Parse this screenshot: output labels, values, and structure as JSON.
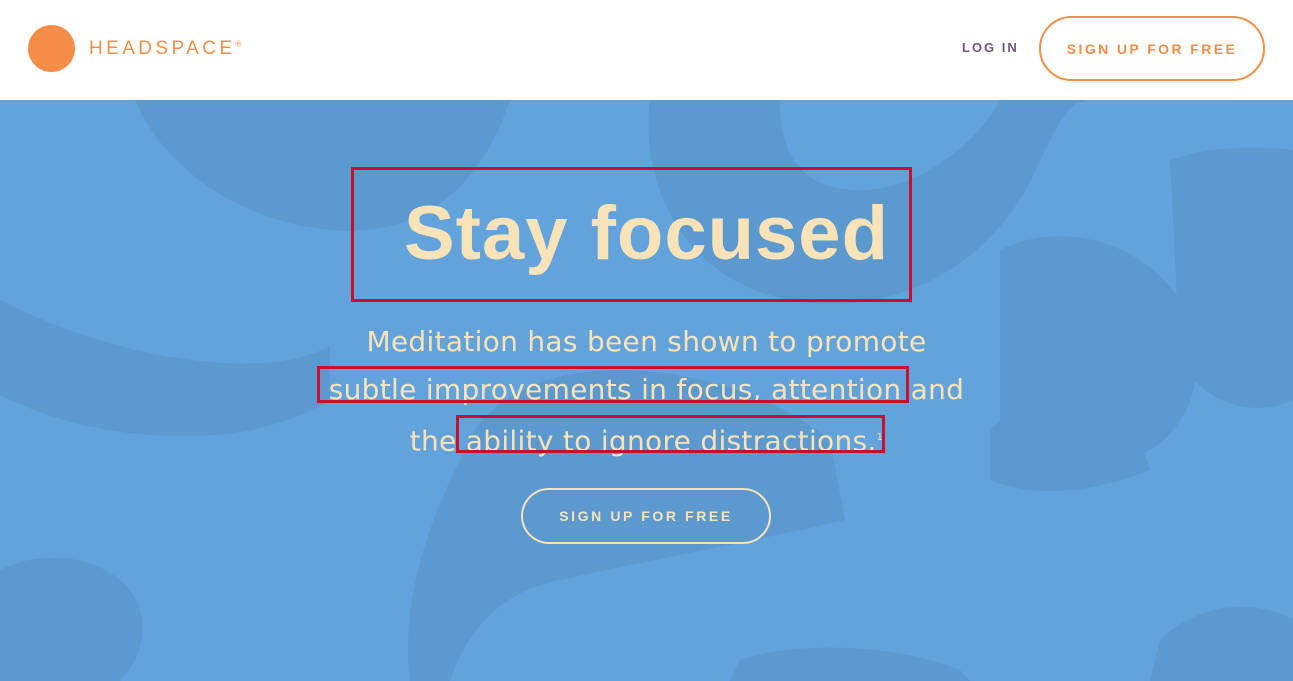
{
  "header": {
    "brand": "HEADSPACE",
    "brand_mark": "®",
    "login_label": "LOG IN",
    "signup_label": "SIGN UP FOR FREE"
  },
  "hero": {
    "title": "Stay focused",
    "subtitle_line1": "Meditation has been shown to promote",
    "subtitle_line2_highlight": "subtle improvements in focus, attention",
    "subtitle_line2_rest": " and",
    "subtitle_line3_prefix": "the ",
    "subtitle_line3_highlight": "ability to ignore distractions.",
    "footnote_marker": "1",
    "cta_label": "SIGN UP FOR FREE"
  },
  "colors": {
    "brand_orange": "#F38D47",
    "hero_blue": "#63A3DB",
    "hero_text": "#F8E2B8",
    "login_text": "#6D5A74",
    "highlight_box": "#C8102E"
  },
  "icons": {
    "logo": "orange-circle-logo-icon"
  }
}
